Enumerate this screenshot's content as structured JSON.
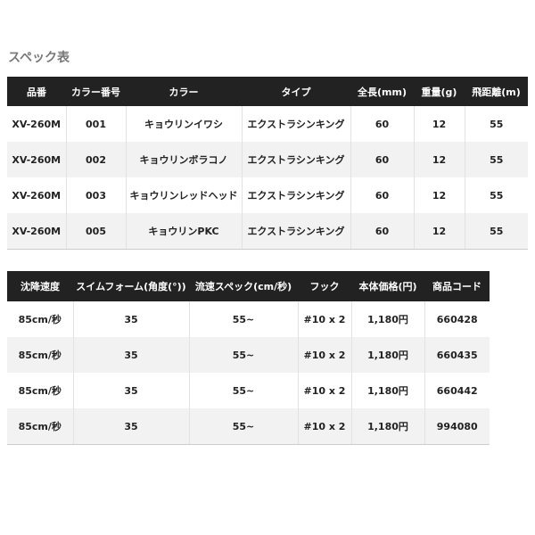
{
  "section_title": "スペック表",
  "table1": {
    "headers": [
      "品番",
      "カラー番号",
      "カラー",
      "タイプ",
      "全長(mm)",
      "重量(g)",
      "飛距離(m)"
    ],
    "rows": [
      [
        "XV-260M",
        "001",
        "キョウリンイワシ",
        "エクストラシンキング",
        "60",
        "12",
        "55"
      ],
      [
        "XV-260M",
        "002",
        "キョウリンボラコノ",
        "エクストラシンキング",
        "60",
        "12",
        "55"
      ],
      [
        "XV-260M",
        "003",
        "キョウリンレッドヘッド",
        "エクストラシンキング",
        "60",
        "12",
        "55"
      ],
      [
        "XV-260M",
        "005",
        "キョウリンPKC",
        "エクストラシンキング",
        "60",
        "12",
        "55"
      ]
    ]
  },
  "table2": {
    "headers": [
      "沈降速度",
      "スイムフォーム(角度(°))",
      "流速スペック(cm/秒)",
      "フック",
      "本体価格(円)",
      "商品コード"
    ],
    "rows": [
      [
        "85cm/秒",
        "35",
        "55~",
        "#10 x 2",
        "1,180円",
        "660428"
      ],
      [
        "85cm/秒",
        "35",
        "55~",
        "#10 x 2",
        "1,180円",
        "660435"
      ],
      [
        "85cm/秒",
        "35",
        "55~",
        "#10 x 2",
        "1,180円",
        "660442"
      ],
      [
        "85cm/秒",
        "35",
        "55~",
        "#10 x 2",
        "1,180円",
        "994080"
      ]
    ]
  },
  "colors": {
    "header_bg": "#222222",
    "header_text": "#ffffff",
    "row_alt_bg": "#f2f2f2",
    "title_text": "#777777"
  }
}
